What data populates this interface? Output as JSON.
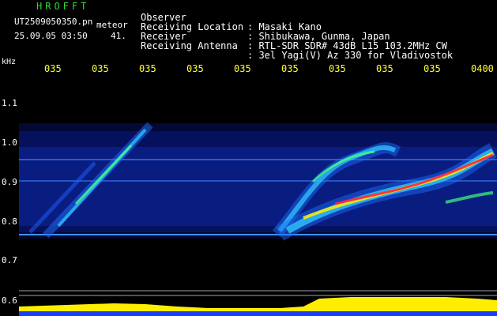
{
  "header": {
    "logo": "HROFFT",
    "filename": "UT2509050350.pn",
    "meteor_label": "meteor",
    "date_time": "25.09.05 03:50",
    "count": "41."
  },
  "info": {
    "rows": [
      {
        "label": "Observer",
        "value": ": Masaki Kano"
      },
      {
        "label": "Receiving Location",
        "value": ": Shibukawa, Gunma, Japan"
      },
      {
        "label": "Receiver",
        "value": ": RTL-SDR SDR# 43dB L15 103.2MHz CW"
      },
      {
        "label": "Receiving Antenna",
        "value": ": 3el Yagi(V) Az 330 for Vladivostok"
      }
    ]
  },
  "axis": {
    "unit": "kHz",
    "time_labels": [
      "035",
      "035",
      "035",
      "035",
      "035",
      "035",
      "035",
      "035",
      "035",
      "0400"
    ],
    "freq_labels": [
      "1.1",
      "1.0",
      "0.9",
      "0.8",
      "0.7",
      "0.6"
    ]
  },
  "colors": {
    "background": "#000000",
    "text_white": "#ffffff",
    "text_yellow": "#ffff30",
    "text_green": "#30d830",
    "noise_blue": "#1a3cff",
    "signal_red": "#ff2040",
    "level_yellow": "#ffee00"
  }
}
